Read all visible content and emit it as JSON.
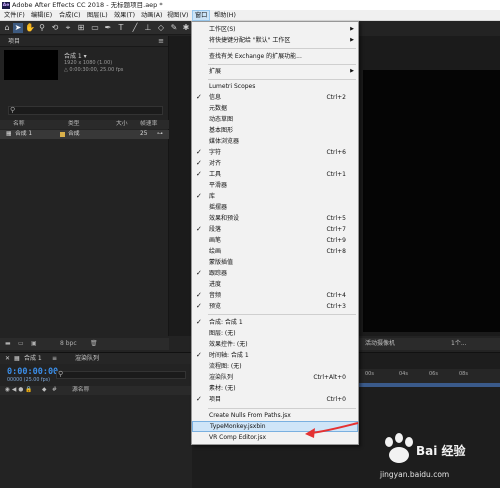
{
  "title_bar": {
    "app_icon": "Ae",
    "title": "Adobe After Effects CC 2018 - 无标题项目.aep *"
  },
  "menubar": [
    {
      "label": "文件(F)"
    },
    {
      "label": "编辑(E)"
    },
    {
      "label": "合成(C)"
    },
    {
      "label": "图层(L)"
    },
    {
      "label": "效果(T)"
    },
    {
      "label": "动画(A)"
    },
    {
      "label": "视图(V)"
    },
    {
      "label": "窗口"
    },
    {
      "label": "帮助(H)"
    }
  ],
  "window_menu": {
    "items": [
      {
        "label": "工作区(S)",
        "shortcut": "",
        "checked": false,
        "submenu": true
      },
      {
        "label": "将快捷键分配给 \"默认\" 工作区",
        "shortcut": "",
        "checked": false,
        "submenu": true
      },
      {
        "label": "查找有关 Exchange 的扩展功能...",
        "shortcut": "",
        "checked": false,
        "submenu": false
      },
      {
        "label": "扩展",
        "shortcut": "",
        "checked": false,
        "submenu": true
      },
      {
        "label": "Lumetri Scopes",
        "shortcut": "",
        "checked": false,
        "submenu": false
      },
      {
        "label": "信息",
        "shortcut": "Ctrl+2",
        "checked": true,
        "submenu": false
      },
      {
        "label": "元数据",
        "shortcut": "",
        "checked": false,
        "submenu": false
      },
      {
        "label": "动态草图",
        "shortcut": "",
        "checked": false,
        "submenu": false
      },
      {
        "label": "基本图形",
        "shortcut": "",
        "checked": false,
        "submenu": false
      },
      {
        "label": "媒体浏览器",
        "shortcut": "",
        "checked": false,
        "submenu": false
      },
      {
        "label": "字符",
        "shortcut": "Ctrl+6",
        "checked": true,
        "submenu": false
      },
      {
        "label": "对齐",
        "shortcut": "",
        "checked": true,
        "submenu": false
      },
      {
        "label": "工具",
        "shortcut": "Ctrl+1",
        "checked": true,
        "submenu": false
      },
      {
        "label": "平滑器",
        "shortcut": "",
        "checked": false,
        "submenu": false
      },
      {
        "label": "库",
        "shortcut": "",
        "checked": true,
        "submenu": false
      },
      {
        "label": "摇摆器",
        "shortcut": "",
        "checked": false,
        "submenu": false
      },
      {
        "label": "效果和预设",
        "shortcut": "Ctrl+5",
        "checked": false,
        "submenu": false
      },
      {
        "label": "段落",
        "shortcut": "Ctrl+7",
        "checked": true,
        "submenu": false
      },
      {
        "label": "画笔",
        "shortcut": "Ctrl+9",
        "checked": false,
        "submenu": false
      },
      {
        "label": "绘画",
        "shortcut": "Ctrl+8",
        "checked": false,
        "submenu": false
      },
      {
        "label": "蒙版插值",
        "shortcut": "",
        "checked": false,
        "submenu": false
      },
      {
        "label": "跟踪器",
        "shortcut": "",
        "checked": true,
        "submenu": false
      },
      {
        "label": "进度",
        "shortcut": "",
        "checked": false,
        "submenu": false
      },
      {
        "label": "音频",
        "shortcut": "Ctrl+4",
        "checked": true,
        "submenu": false
      },
      {
        "label": "预览",
        "shortcut": "Ctrl+3",
        "checked": true,
        "submenu": false
      },
      {
        "label": "合成: 合成 1",
        "shortcut": "",
        "checked": true,
        "submenu": false
      },
      {
        "label": "图层: (无)",
        "shortcut": "",
        "checked": false,
        "submenu": false
      },
      {
        "label": "效果控件: (无)",
        "shortcut": "",
        "checked": false,
        "submenu": false
      },
      {
        "label": "时间轴: 合成 1",
        "shortcut": "",
        "checked": true,
        "submenu": false
      },
      {
        "label": "流程图: (无)",
        "shortcut": "",
        "checked": false,
        "submenu": false
      },
      {
        "label": "渲染队列",
        "shortcut": "Ctrl+Alt+0",
        "checked": false,
        "submenu": false
      },
      {
        "label": "素材: (无)",
        "shortcut": "",
        "checked": false,
        "submenu": false
      },
      {
        "label": "项目",
        "shortcut": "Ctrl+0",
        "checked": true,
        "submenu": false
      },
      {
        "label": "Create Nulls From Paths.jsx",
        "shortcut": "",
        "checked": false,
        "submenu": false
      },
      {
        "label": "TypeMonkey.jsxbin",
        "shortcut": "",
        "checked": false,
        "submenu": false,
        "highlighted": true
      },
      {
        "label": "VR Comp Editor.jsx",
        "shortcut": "",
        "checked": false,
        "submenu": false
      }
    ]
  },
  "project_panel": {
    "tab": "项目",
    "comp_name": "合成 1 ▾",
    "comp_info": [
      "1920 x 1080 (1.00)",
      "△ 0:00:30:00, 25.00 fps"
    ],
    "columns": [
      "名称",
      "类型",
      "大小",
      "帧速率"
    ],
    "rows": [
      {
        "name": "合成 1",
        "type": "合成",
        "fps": "25"
      }
    ],
    "bottom_bpc": "8 bpc"
  },
  "viewer_bottom": {
    "camera": "活动摄像机",
    "views": "1个..."
  },
  "timeline": {
    "tab": "合成 1",
    "render_tab": "渲染队列",
    "timecode": "0:00:00:00",
    "timecode_sub": "00000 (25.00 fps)",
    "columns": [
      "源名称"
    ],
    "ruler": [
      "00s",
      "04s",
      "06s",
      "08s"
    ]
  },
  "watermark": {
    "text": "Bai 经验",
    "url": "jingyan.baidu.com"
  }
}
